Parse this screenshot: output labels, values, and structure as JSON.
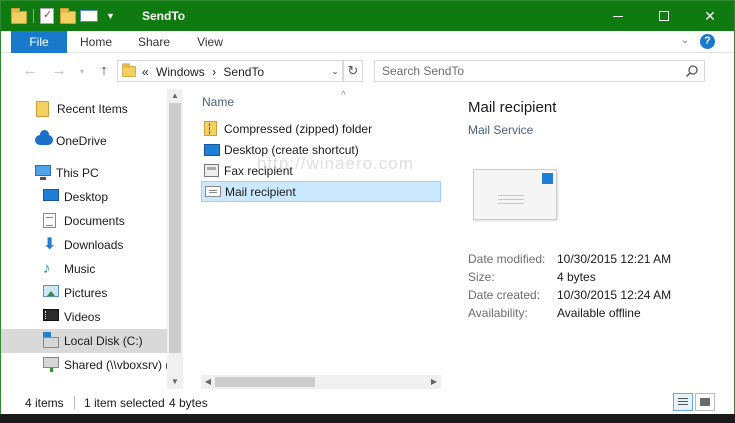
{
  "window": {
    "title": "SendTo",
    "controls": {
      "minimize": "minimize",
      "maximize": "maximize",
      "close": "close"
    }
  },
  "ribbon": {
    "tabs": [
      {
        "label": "File"
      },
      {
        "label": "Home"
      },
      {
        "label": "Share"
      },
      {
        "label": "View"
      }
    ]
  },
  "address": {
    "overflow": "«",
    "crumbs": [
      "Windows",
      "SendTo"
    ],
    "search_placeholder": "Search SendTo"
  },
  "navigation": {
    "items": [
      {
        "label": "Recent Items",
        "icon": "folder-icon"
      },
      {
        "label": "OneDrive",
        "icon": "cloud-icon"
      },
      {
        "label": "This PC",
        "icon": "computer-icon"
      },
      {
        "label": "Desktop",
        "icon": "desktop-icon"
      },
      {
        "label": "Documents",
        "icon": "documents-icon"
      },
      {
        "label": "Downloads",
        "icon": "downloads-icon"
      },
      {
        "label": "Music",
        "icon": "music-icon"
      },
      {
        "label": "Pictures",
        "icon": "pictures-icon"
      },
      {
        "label": "Videos",
        "icon": "videos-icon"
      },
      {
        "label": "Local Disk (C:)",
        "icon": "disk-icon",
        "selected": true
      },
      {
        "label": "Shared (\\\\vboxsrv) (E",
        "icon": "network-drive-icon"
      }
    ]
  },
  "filelist": {
    "column_header": "Name",
    "files": [
      {
        "name": "Compressed (zipped) folder",
        "icon": "zip-folder-icon"
      },
      {
        "name": "Desktop (create shortcut)",
        "icon": "desktop-shortcut-icon"
      },
      {
        "name": "Fax recipient",
        "icon": "fax-icon"
      },
      {
        "name": "Mail recipient",
        "icon": "mail-icon",
        "selected": true
      }
    ]
  },
  "watermark": "http://winaero.com",
  "details": {
    "title": "Mail recipient",
    "type": "Mail Service",
    "properties": [
      {
        "label": "Date modified:",
        "value": "10/30/2015 12:21 AM"
      },
      {
        "label": "Size:",
        "value": "4 bytes"
      },
      {
        "label": "Date created:",
        "value": "10/30/2015 12:24 AM"
      },
      {
        "label": "Availability:",
        "value": "Available offline"
      }
    ]
  },
  "status": {
    "item_count": "4 items",
    "selection": "1 item selected",
    "selection_size": "4 bytes"
  },
  "colors": {
    "titlebar": "#0f7a0f",
    "file_tab": "#1979ca",
    "selection": "#cce8ff"
  }
}
